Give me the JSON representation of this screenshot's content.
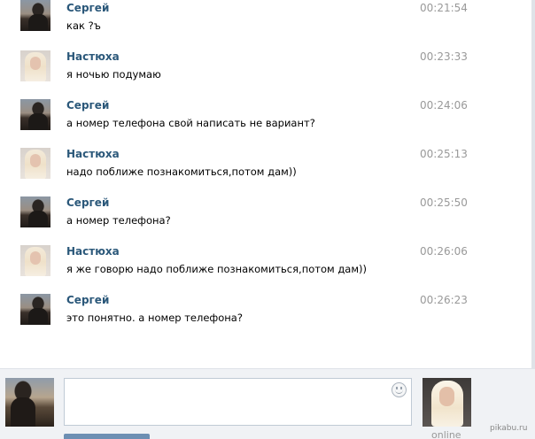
{
  "messages": [
    {
      "sender": "Сергей",
      "time": "00:21:54",
      "text": "как ?ъ",
      "avatar": "sergey"
    },
    {
      "sender": "Настюха",
      "time": "00:23:33",
      "text": "я ночью подумаю",
      "avatar": "nastyuha"
    },
    {
      "sender": "Сергей",
      "time": "00:24:06",
      "text": "а номер телефона свой написать не вариант?",
      "avatar": "sergey"
    },
    {
      "sender": "Настюха",
      "time": "00:25:13",
      "text": "надо поближе познакомиться,потом дам))",
      "avatar": "nastyuha"
    },
    {
      "sender": "Сергей",
      "time": "00:25:50",
      "text": "а номер телефона?",
      "avatar": "sergey"
    },
    {
      "sender": "Настюха",
      "time": "00:26:06",
      "text": "я же говорю надо поближе познакомиться,потом дам))",
      "avatar": "nastyuha"
    },
    {
      "sender": "Сергей",
      "time": "00:26:23",
      "text": "это понятно. а номер телефона?",
      "avatar": "sergey"
    }
  ],
  "composer": {
    "input_value": "",
    "peer_status": "online"
  },
  "watermark": "pikabu.ru",
  "colors": {
    "sender": "#2b587a",
    "time": "#999999",
    "composer_bg": "#f0f2f5",
    "send_button": "#6d8fb3"
  }
}
